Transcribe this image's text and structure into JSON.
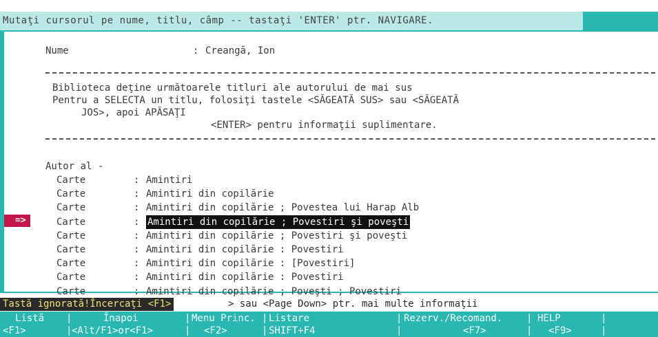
{
  "top_bar": {
    "message": "Mutaţi cursorul pe nume, titlu, câmp -- tastaţi 'ENTER' ptr. NAVIGARE."
  },
  "author": {
    "label": "Nume",
    "separator": ":",
    "value": "Creangă, Ion"
  },
  "instructions": {
    "line1": "Biblioteca deţine următoarele titluri ale autorului de mai sus",
    "line2": "Pentru a SELECTA un titlu, folosiţi tastele <SĂGEATĂ SUS> sau <SĂGEATĂ",
    "line3": "JOS>, apoi APĂSAŢI",
    "line4": "<ENTER> pentru informaţii suplimentare."
  },
  "list": {
    "heading": "Autor al -",
    "cursor": "=>",
    "selected_index": 3,
    "items": [
      {
        "type": "Carte",
        "title": "Amintiri"
      },
      {
        "type": "Carte",
        "title": "Amintiri din copilărie"
      },
      {
        "type": "Carte",
        "title": "Amintiri din copilărie ; Povestea lui Harap Alb"
      },
      {
        "type": "Carte",
        "title": "Amintiri din copilărie ; Povestiri şi poveşti"
      },
      {
        "type": "Carte",
        "title": "Amintiri din copilărie ; Povestiri şi poveşti"
      },
      {
        "type": "Carte",
        "title": "Amintiri din copilărie : Povestiri"
      },
      {
        "type": "Carte",
        "title": "Amintiri din copilărie : [Povestiri]"
      },
      {
        "type": "Carte",
        "title": "Amintiri din copilărie : Povestiri"
      },
      {
        "type": "Carte",
        "title": "Amintiri din copilărie ; Poveşti ; Povestiri"
      }
    ]
  },
  "bottom": {
    "warning": "Tastă ignorată!Încercaţi <F1>",
    "more": "> sau <Page Down> ptr. mai multe informaţii"
  },
  "function_keys": [
    {
      "label": "Listă",
      "key": "<F1>"
    },
    {
      "label": "Înapoi",
      "key": "<Alt/F1>or<F1>"
    },
    {
      "label": "Menu Princ.",
      "key": "<F2>"
    },
    {
      "label": "Listare",
      "key": "SHIFT+F4"
    },
    {
      "label": "Rezerv./Recomand.",
      "key": "<F7>"
    },
    {
      "label": "HELP",
      "key": "<F9>"
    }
  ],
  "colors": {
    "accent_teal": "#2ab7b1",
    "top_message_bg": "#b9e8e6",
    "cursor_marker": "#c3174a",
    "selection_bg": "#111111",
    "warning_fg": "#f2e27a"
  }
}
